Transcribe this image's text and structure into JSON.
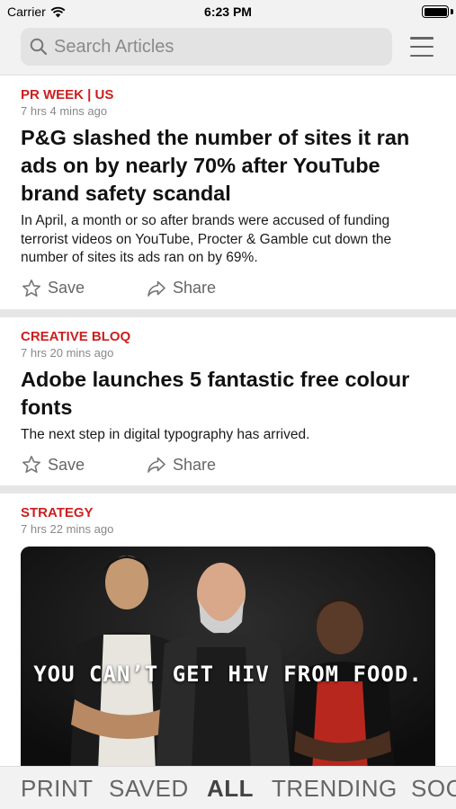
{
  "status_bar": {
    "carrier": "Carrier",
    "time": "6:23 PM",
    "battery_level": 1.0
  },
  "search": {
    "placeholder": "Search Articles",
    "icon": "magnifier",
    "menu_icon": "hamburger"
  },
  "colors": {
    "accent": "#cc1f1f",
    "header_bg": "#f2f2f2",
    "separator": "#e6e6e6"
  },
  "articles": [
    {
      "source": "PR WEEK | US",
      "time": "7 hrs 4 mins ago",
      "headline": "P&G slashed the number of sites it ran ads on by nearly 70% after YouTube brand safety scandal",
      "summary": "In April, a month or so after brands were accused of funding terrorist videos on YouTube, Procter & Gamble cut down the number of sites its ads ran on by 69%.",
      "save_label": "Save",
      "share_label": "Share"
    },
    {
      "source": "CREATIVE BLOQ",
      "time": "7 hrs 20 mins ago",
      "headline": "Adobe launches 5 fantastic free colour fonts",
      "summary": "The next step in digital typography has arrived.",
      "save_label": "Save",
      "share_label": "Share"
    },
    {
      "source": "STRATEGY",
      "time": "7 hrs 22 mins ago",
      "image_caption": "YOU CAN’T GET HIV FROM FOOD."
    }
  ],
  "tabs": [
    {
      "label": "PRINT",
      "active": false
    },
    {
      "label": "SAVED",
      "active": false
    },
    {
      "label": "ALL",
      "active": true
    },
    {
      "label": "TRENDING",
      "active": false
    },
    {
      "label": "SOCIAL",
      "active": false
    }
  ]
}
